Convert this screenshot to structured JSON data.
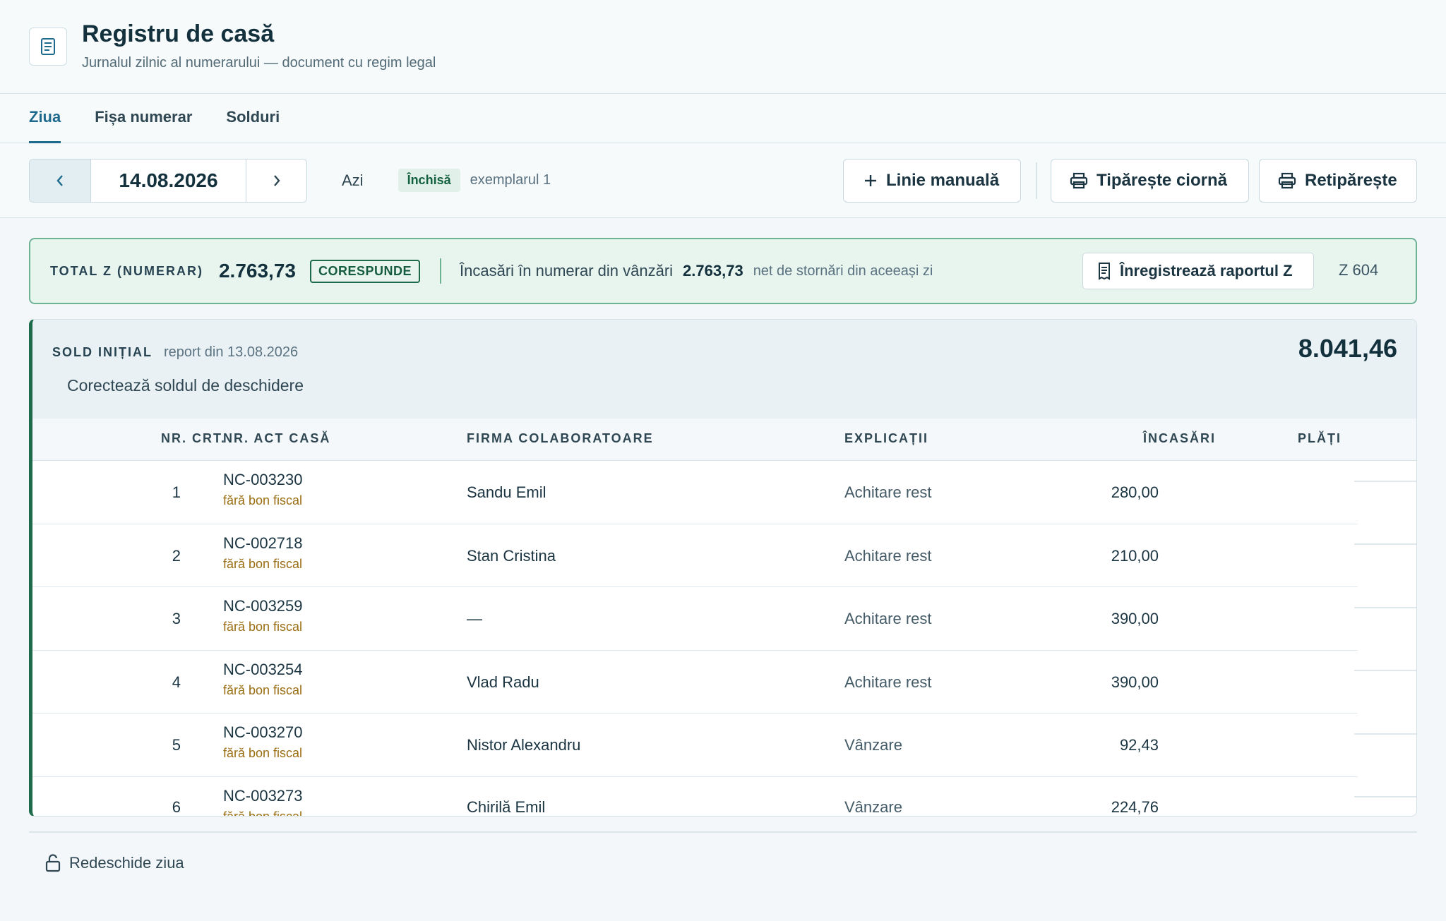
{
  "header": {
    "title": "Registru de casă",
    "subtitle": "Jurnalul zilnic al numerarului — document cu regim legal",
    "icon": "ledger-document-icon"
  },
  "tabs": [
    {
      "label": "Ziua",
      "active": true
    },
    {
      "label": "Fișa numerar",
      "active": false
    },
    {
      "label": "Solduri",
      "active": false
    }
  ],
  "toolbar": {
    "date": "14.08.2026",
    "today_label": "Azi",
    "status": "Închisă",
    "copy": "exemplarul 1",
    "manual_line_label": "Linie manuală",
    "print_draft_label": "Tipărește ciornă",
    "reprint_label": "Retipărește"
  },
  "z_total": {
    "label": "TOTAL Z (NUMERAR)",
    "amount": "2.763,73",
    "badge": "CORESPUNDE",
    "description": "Încasări în numerar din vânzări",
    "sales_amount": "2.763,73",
    "note": "net de stornări din aceeași zi",
    "register_label": "Înregistrează raportul Z",
    "z_number": "Z 604"
  },
  "opening_balance": {
    "label": "SOLD INIȚIAL",
    "source": "report din 13.08.2026",
    "correct_label": "Corectează soldul de deschidere",
    "amount": "8.041,46"
  },
  "table": {
    "headers": [
      "NR. CRT.",
      "NR. ACT CASĂ",
      "FIRMA COLABORATOARE",
      "EXPLICAȚII",
      "ÎNCASĂRI",
      "PLĂȚI"
    ],
    "rows": [
      {
        "nr": "1",
        "act": "NC-003230",
        "fiscal": "fără bon fiscal",
        "firm": "Sandu Emil",
        "expl": "Achitare rest",
        "inc": "280,00"
      },
      {
        "nr": "2",
        "act": "NC-002718",
        "fiscal": "fără bon fiscal",
        "firm": "Stan Cristina",
        "expl": "Achitare rest",
        "inc": "210,00"
      },
      {
        "nr": "3",
        "act": "NC-003259",
        "fiscal": "fără bon fiscal",
        "firm": "—",
        "expl": "Achitare rest",
        "inc": "390,00"
      },
      {
        "nr": "4",
        "act": "NC-003254",
        "fiscal": "fără bon fiscal",
        "firm": "Vlad Radu",
        "expl": "Achitare rest",
        "inc": "390,00"
      },
      {
        "nr": "5",
        "act": "NC-003270",
        "fiscal": "fără bon fiscal",
        "firm": "Nistor Alexandru",
        "expl": "Vânzare",
        "inc": "92,43"
      },
      {
        "nr": "6",
        "act": "NC-003273",
        "fiscal": "fără bon fiscal",
        "firm": "Chirilă Emil",
        "expl": "Vânzare",
        "inc": "224,76"
      }
    ]
  },
  "footer": {
    "reopen_label": "Redeschide ziua"
  },
  "colors": {
    "accent": "#1e6a8d",
    "success": "#1e6b4c",
    "fiscal_warning": "#9a6d12"
  }
}
